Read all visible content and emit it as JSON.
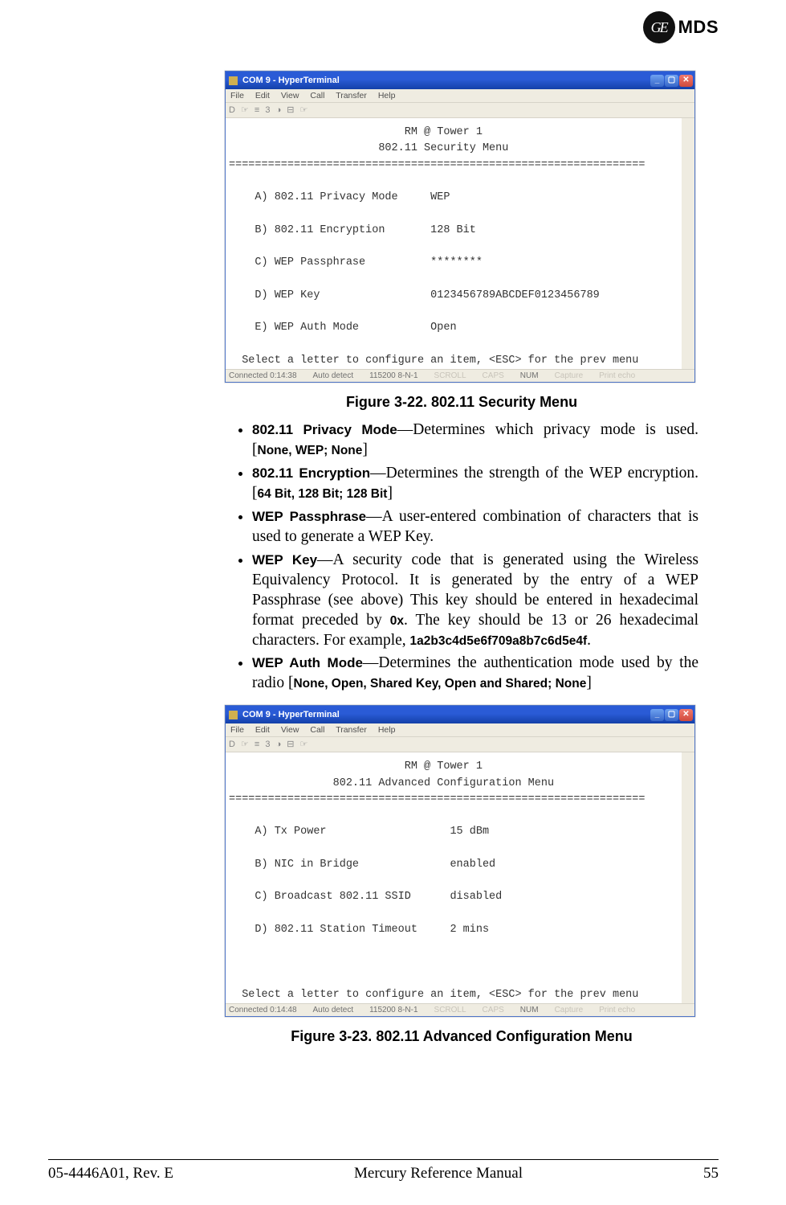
{
  "brand": {
    "ge": "GE",
    "mds": "MDS"
  },
  "terminal1": {
    "title": "COM 9 - HyperTerminal",
    "menus": [
      "File",
      "Edit",
      "View",
      "Call",
      "Transfer",
      "Help"
    ],
    "toolbar_glyphs": "D ☞  ≡ 3  ◑ ⊟  ☞",
    "header1": "RM @ Tower 1",
    "header2": "802.11 Security Menu",
    "rows": [
      {
        "label": "A) 802.11 Privacy Mode",
        "value": "WEP"
      },
      {
        "label": "B) 802.11 Encryption",
        "value": "128 Bit"
      },
      {
        "label": "C) WEP Passphrase",
        "value": "********"
      },
      {
        "label": "D) WEP Key",
        "value": "0123456789ABCDEF0123456789"
      },
      {
        "label": "E) WEP Auth Mode",
        "value": "Open"
      }
    ],
    "prompt": "Select a letter to configure an item, <ESC> for the prev menu",
    "status": {
      "conn": "Connected 0:14:38",
      "auto": "Auto detect",
      "baud": "115200 8-N-1",
      "f1": "SCROLL",
      "f2": "CAPS",
      "f3": "NUM",
      "f4": "Capture",
      "f5": "Print echo"
    }
  },
  "terminal2": {
    "title": "COM 9 - HyperTerminal",
    "menus": [
      "File",
      "Edit",
      "View",
      "Call",
      "Transfer",
      "Help"
    ],
    "toolbar_glyphs": "D ☞  ≡ 3  ◑ ⊟  ☞",
    "header1": "RM @ Tower 1",
    "header2": "802.11 Advanced Configuration Menu",
    "rows": [
      {
        "label": "A) Tx Power",
        "value": "15 dBm"
      },
      {
        "label": "B) NIC in Bridge",
        "value": "enabled"
      },
      {
        "label": "C) Broadcast 802.11 SSID",
        "value": "disabled"
      },
      {
        "label": "D) 802.11 Station Timeout",
        "value": "2 mins"
      }
    ],
    "prompt": "Select a letter to configure an item, <ESC> for the prev menu",
    "status": {
      "conn": "Connected 0:14:48",
      "auto": "Auto detect",
      "baud": "115200 8-N-1",
      "f1": "SCROLL",
      "f2": "CAPS",
      "f3": "NUM",
      "f4": "Capture",
      "f5": "Print echo"
    }
  },
  "captions": {
    "fig1": "Figure 3-22. 802.11 Security Menu",
    "fig2": "Figure 3-23. 802.11 Advanced Configuration Menu"
  },
  "bullets": {
    "b1_term": "802.11 Privacy Mode",
    "b1_text": "—Determines which privacy mode is used. [",
    "b1_opts": "None, WEP; None",
    "b1_end": "]",
    "b2_term": "802.11 Encryption",
    "b2_text": "—Determines the strength of the WEP encryp­tion. [",
    "b2_opts": "64 Bit, 128 Bit; 128 Bit",
    "b2_end": "]",
    "b3_term": "WEP Passphrase",
    "b3_text": "—A user-entered combination of characters that is used to generate a WEP Key.",
    "b4_term": "WEP Key",
    "b4_text_a": "—A security code that is generated using the Wireless Equivalency Protocol. It is generated by the entry of a WEP Passphrase (see above) This key should be entered in hexadec­imal format preceded by ",
    "b4_code": "0x",
    "b4_text_b": ". The key should be 13 or 26 hexa­decimal characters. For example, ",
    "b4_example": "1a2b3c4d5e6f709a8b7c6d5e4f",
    "b4_text_c": ".",
    "b5_term": "WEP Auth Mode",
    "b5_text": "—Determines the authentication mode used by the radio [",
    "b5_opts": "None, Open, Shared Key, Open and Shared; None",
    "b5_end": "]"
  },
  "footer": {
    "left": "05-4446A01, Rev. E",
    "center": "Mercury Reference Manual",
    "right": "55"
  }
}
